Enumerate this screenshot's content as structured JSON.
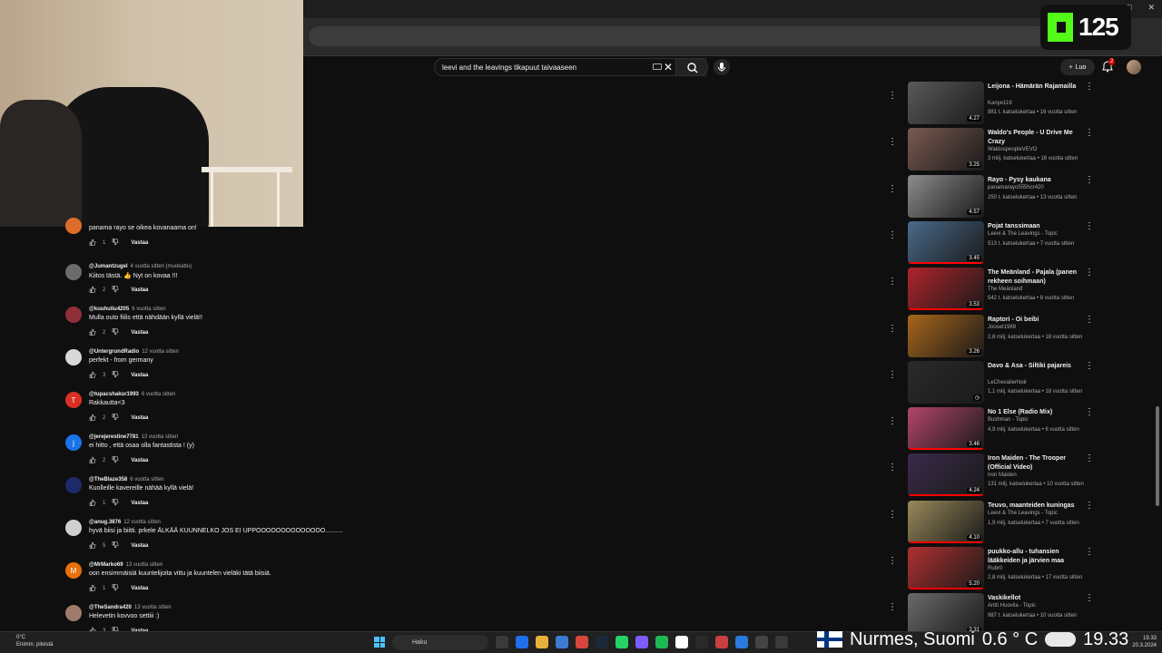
{
  "search": {
    "query": "leevi and the leavings tikapuut taivaaseen"
  },
  "header": {
    "create_label": "Luo",
    "notifications_count": "2"
  },
  "kick_overlay": {
    "viewers": "125"
  },
  "comments": [
    {
      "user": "",
      "time": "",
      "text": "panama rayo se oikea kovanaama on!",
      "likes": "1",
      "avatar_color": "#e06c2b",
      "avatar_letter": ""
    },
    {
      "user": "@Jumantzugel",
      "time": "4 vuotta sitten (muokattu)",
      "text": "Kiitos tästä. 👍 Nyt on kovaa !!!",
      "likes": "2",
      "avatar_color": "#6b6b6b",
      "avatar_letter": ""
    },
    {
      "user": "@kuuhuliu4205",
      "time": "6 vuotta sitten",
      "text": "Mulla outo fiilis että nähdään kyllä vielä!!",
      "likes": "2",
      "avatar_color": "#8e2f3a",
      "avatar_letter": ""
    },
    {
      "user": "@UntergrundRadio",
      "time": "12 vuotta sitten",
      "text": "perfekt - from germany",
      "likes": "3",
      "avatar_color": "#d9d9d9",
      "avatar_letter": ""
    },
    {
      "user": "@tupacshakur1993",
      "time": "6 vuotta sitten",
      "text": "Rakkautta<3",
      "likes": "2",
      "avatar_color": "#d93025",
      "avatar_letter": "T"
    },
    {
      "user": "@jerejerestine7781",
      "time": "13 vuotta sitten",
      "text": "ei hitto , että osaa olla fantastista ! (y)",
      "likes": "2",
      "avatar_color": "#1a73e8",
      "avatar_letter": "j"
    },
    {
      "user": "@TheBlaze358",
      "time": "6 vuotta sitten",
      "text": "Kuolleille kavereille nähää kyllä vielä!",
      "likes": "1",
      "avatar_color": "#1f2a6b",
      "avatar_letter": ""
    },
    {
      "user": "@anug.3876",
      "time": "12 vuotta sitten",
      "text": "hyvä biisi ja biitti. prkele ÄLKÄÄ KUUNNELKO JOS EI UPPOOOOOOOOOOOOOO..........",
      "likes": "5",
      "avatar_color": "#cfcfcf",
      "avatar_letter": ""
    },
    {
      "user": "@MrMarko69",
      "time": "13 vuotta sitten",
      "text": "oon ensimmäisiä kuuntelijoita vittu ja kuuntelen vieläki tätä biisiä.",
      "likes": "1",
      "avatar_color": "#e8710a",
      "avatar_letter": "M"
    },
    {
      "user": "@TheSandra420",
      "time": "13 vuotta sitten",
      "text": "Helevetin kovvoo settiii :)",
      "likes": "3",
      "avatar_color": "#a07a6a",
      "avatar_letter": ""
    }
  ],
  "reply_label": "Vastaa",
  "related": [
    {
      "title": "Leijona - Hämärän Rajamailla",
      "channel": "Kanye119",
      "meta": "881 t. katselukertaa • 16 vuotta sitten",
      "duration": "4.27",
      "thumb": "#5a5a5a",
      "progress": 0
    },
    {
      "title": "Waldo's People - U Drive Me Crazy",
      "channel": "WaldospeopleVEVO",
      "meta": "3 milj. katselukertaa • 16 vuotta sitten",
      "duration": "3.25",
      "thumb": "#7a5a50",
      "progress": 0
    },
    {
      "title": "Rayo - Pysy kaukana",
      "channel": "panamarayo555hcr420",
      "meta": "250 t. katselukertaa • 13 vuotta sitten",
      "duration": "4.57",
      "thumb": "#8c8c8c",
      "progress": 0
    },
    {
      "title": "Pojat tanssimaan",
      "channel": "Leevi & The Leavings - Topic",
      "meta": "513 t. katselukertaa • 7 vuotta sitten",
      "duration": "3.45",
      "thumb": "#4a6a8a",
      "progress": 1
    },
    {
      "title": "The Meänland - Pajala (panen rekheen soihmaan)",
      "channel": "The Meänland",
      "meta": "542 t. katselukertaa • 8 vuotta sitten",
      "duration": "3.53",
      "thumb": "#b0242b",
      "progress": 1
    },
    {
      "title": "Raptori - Oi beibi",
      "channel": "Jooset1989",
      "meta": "2,8 milj. katselukertaa • 18 vuotta sitten",
      "duration": "3.26",
      "thumb": "#a8661a",
      "progress": 0
    },
    {
      "title": "Davo & Asa - Siltiki pajareis",
      "channel": "LeChevalierNoir",
      "meta": "1,1 milj. katselukertaa • 18 vuotta sitten",
      "duration": "",
      "thumb": "#2a2a2a",
      "progress": 0
    },
    {
      "title": "No 1 Else (Radio Mix)",
      "channel": "Bushman - Topic",
      "meta": "4,9 milj. katselukertaa • 6 vuotta sitten",
      "duration": "3.46",
      "thumb": "#b3456a",
      "progress": 1
    },
    {
      "title": "Iron Maiden - The Trooper (Official Video)",
      "channel": "Iron Maiden",
      "meta": "131 milj. katselukertaa • 10 vuotta sitten",
      "duration": "4.24",
      "thumb": "#3a2a4a",
      "progress": 1
    },
    {
      "title": "Teuvo, maanteiden kuningas",
      "channel": "Leevi & The Leavings - Topic",
      "meta": "1,9 milj. katselukertaa • 7 vuotta sitten",
      "duration": "4.10",
      "thumb": "#9a8a5a",
      "progress": 1
    },
    {
      "title": "puukko-allu - tuhansien lääkkeiden ja järvien maa",
      "channel": "Rubr0",
      "meta": "2,8 milj. katselukertaa • 17 vuotta sitten",
      "duration": "5.20",
      "thumb": "#b03030",
      "progress": 1
    },
    {
      "title": "Vaskikellot",
      "channel": "Antti Huovila - Topic",
      "meta": "987 t. katselukertaa • 10 vuotta sitten",
      "duration": "3.31",
      "thumb": "#6a6a6a",
      "progress": 0
    }
  ],
  "taskbar": {
    "weather_line1": "0°C",
    "weather_line2": "Enimm. pilvistä",
    "search_label": "Haku",
    "time": "19.33",
    "date": "20.3.2024"
  },
  "location_overlay": {
    "place": "Nurmes, Suomi",
    "temp": "0.6 ° C",
    "time": "19.33"
  }
}
